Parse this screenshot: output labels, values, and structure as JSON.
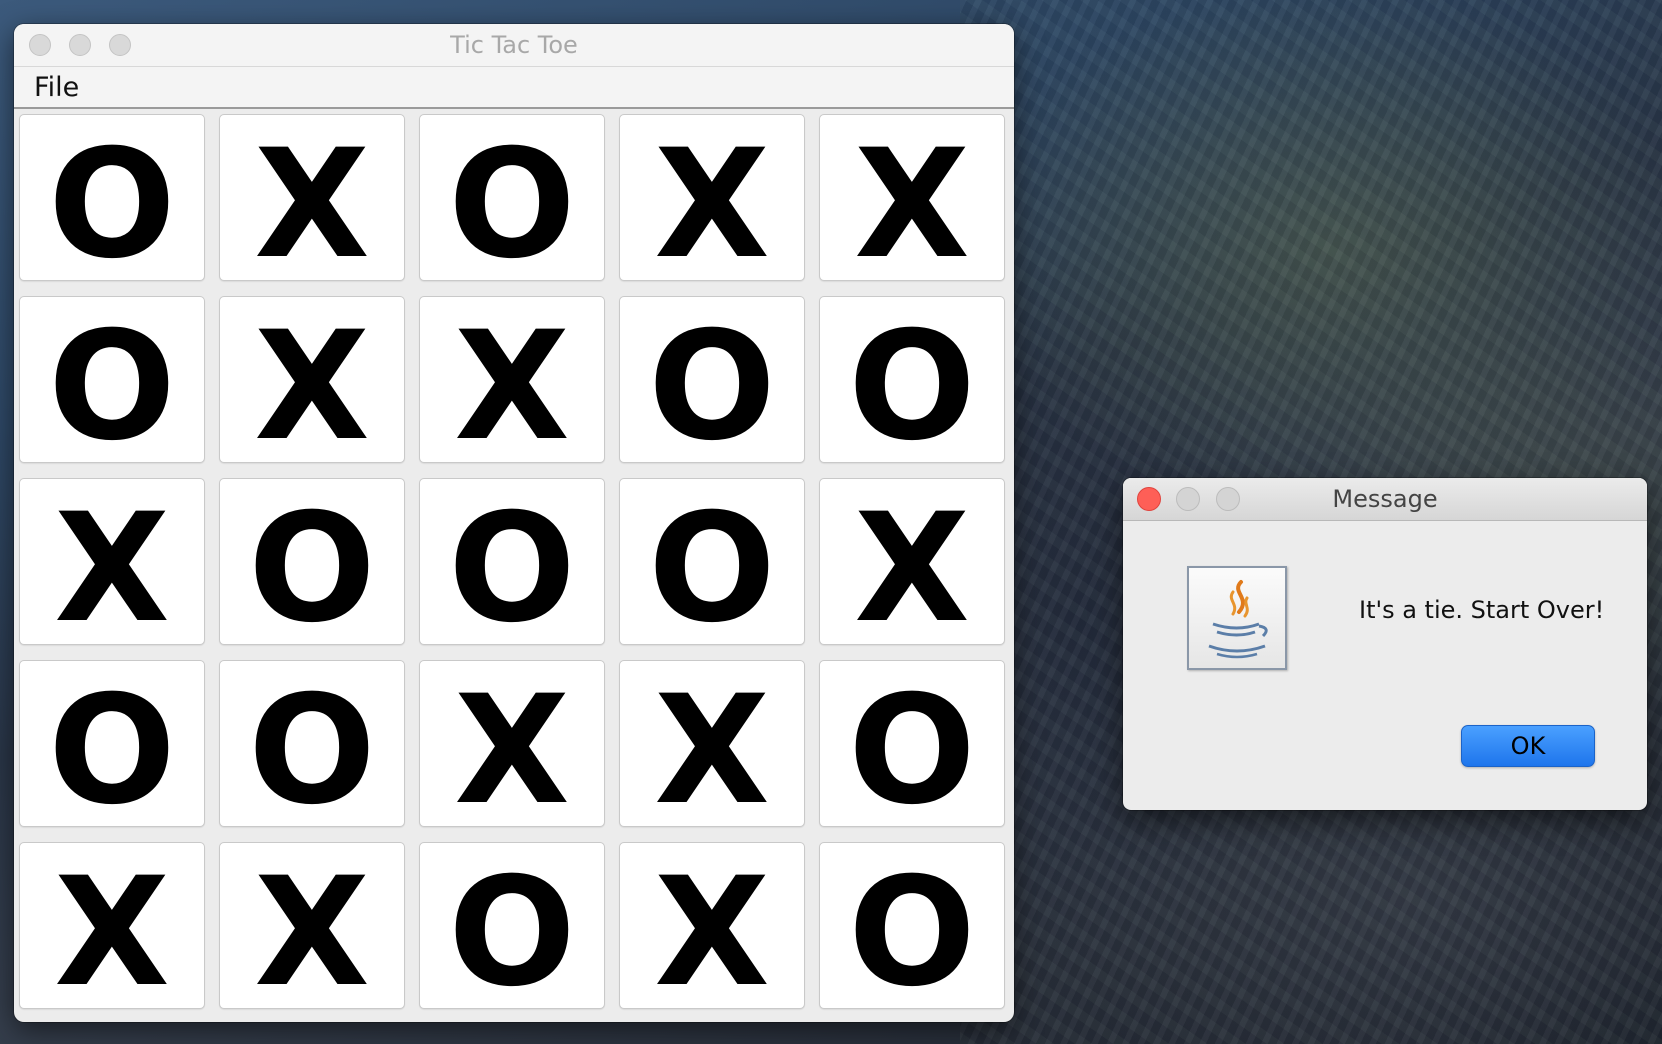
{
  "main_window": {
    "title": "Tic Tac Toe",
    "menu": {
      "file_label": "File"
    },
    "board": [
      [
        "O",
        "X",
        "O",
        "X",
        "X"
      ],
      [
        "O",
        "X",
        "X",
        "O",
        "O"
      ],
      [
        "X",
        "O",
        "O",
        "O",
        "X"
      ],
      [
        "O",
        "O",
        "X",
        "X",
        "O"
      ],
      [
        "X",
        "X",
        "O",
        "X",
        "O"
      ]
    ]
  },
  "dialog": {
    "title": "Message",
    "icon": "java-coffee-cup-icon",
    "message": "It's a tie. Start Over!",
    "ok_label": "OK"
  },
  "colors": {
    "close_button": "#fe5f57",
    "ok_button": "#1e75ec"
  }
}
